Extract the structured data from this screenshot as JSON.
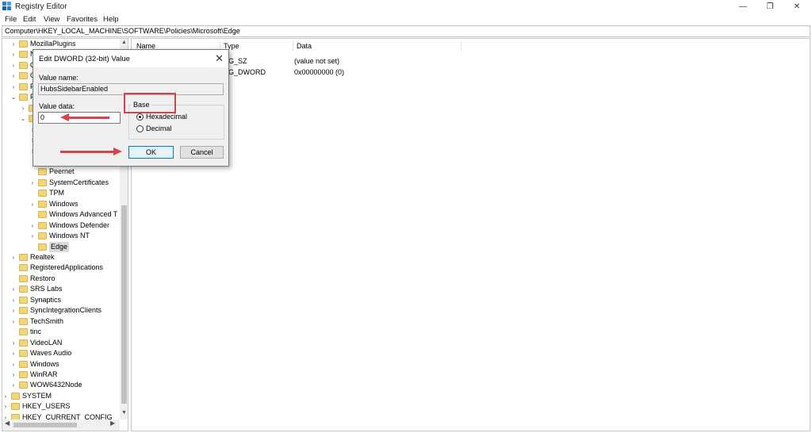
{
  "window": {
    "title": "Registry Editor",
    "controls": {
      "minimize": "—",
      "maximize": "❐",
      "close": "✕"
    }
  },
  "menu": [
    "File",
    "Edit",
    "View",
    "Favorites",
    "Help"
  ],
  "address": "Computer\\HKEY_LOCAL_MACHINE\\SOFTWARE\\Policies\\Microsoft\\Edge",
  "tree": [
    {
      "label": "MozillaPlugins",
      "chev": "›"
    },
    {
      "label": "N",
      "chev": "›"
    },
    {
      "label": "O",
      "chev": "›"
    },
    {
      "label": "O",
      "chev": "›"
    },
    {
      "label": "P",
      "chev": "›"
    },
    {
      "label": "P",
      "chev": "⌄"
    },
    {
      "label": "",
      "chev": "›"
    },
    {
      "label": "",
      "chev": "⌄"
    },
    {
      "label": "",
      "chev": "›"
    },
    {
      "label": "",
      "chev": "›"
    },
    {
      "label": "",
      "chev": "›"
    },
    {
      "label": "",
      "chev": ""
    },
    {
      "label": "Peernet",
      "chev": ""
    },
    {
      "label": "SystemCertificates",
      "chev": "›"
    },
    {
      "label": "TPM",
      "chev": ""
    },
    {
      "label": "Windows",
      "chev": "›"
    },
    {
      "label": "Windows Advanced T",
      "chev": ""
    },
    {
      "label": "Windows Defender",
      "chev": "›"
    },
    {
      "label": "Windows NT",
      "chev": "›"
    },
    {
      "label": "Edge",
      "chev": ""
    },
    {
      "label": "Realtek",
      "chev": "›"
    },
    {
      "label": "RegisteredApplications",
      "chev": ""
    },
    {
      "label": "Restoro",
      "chev": ""
    },
    {
      "label": "SRS Labs",
      "chev": "›"
    },
    {
      "label": "Synaptics",
      "chev": "›"
    },
    {
      "label": "SyncIntegrationClients",
      "chev": "›"
    },
    {
      "label": "TechSmith",
      "chev": "›"
    },
    {
      "label": "tinc",
      "chev": ""
    },
    {
      "label": "VideoLAN",
      "chev": "›"
    },
    {
      "label": "Waves Audio",
      "chev": "›"
    },
    {
      "label": "Windows",
      "chev": "›"
    },
    {
      "label": "WinRAR",
      "chev": "›"
    },
    {
      "label": "WOW6432Node",
      "chev": "›"
    },
    {
      "label": "SYSTEM",
      "chev": "›"
    },
    {
      "label": "HKEY_USERS",
      "chev": "›"
    },
    {
      "label": "HKEY_CURRENT_CONFIG",
      "chev": "›"
    }
  ],
  "list": {
    "columns": [
      "Name",
      "Type",
      "Data"
    ],
    "rows": [
      {
        "type": "G_SZ",
        "data": "(value not set)"
      },
      {
        "type": "G_DWORD",
        "data": "0x00000000 (0)"
      }
    ]
  },
  "dialog": {
    "title": "Edit DWORD (32-bit) Value",
    "close": "✕",
    "value_name_label": "Value name:",
    "value_name": "HubsSidebarEnabled",
    "value_data_label": "Value data:",
    "value_data": "0",
    "base_label": "Base",
    "radio_hex": "Hexadecimal",
    "radio_dec": "Decimal",
    "ok": "OK",
    "cancel": "Cancel"
  },
  "colors": {
    "annotation": "#d9424a",
    "folder": "#f3d67a",
    "selection": "#d9d9d9"
  }
}
